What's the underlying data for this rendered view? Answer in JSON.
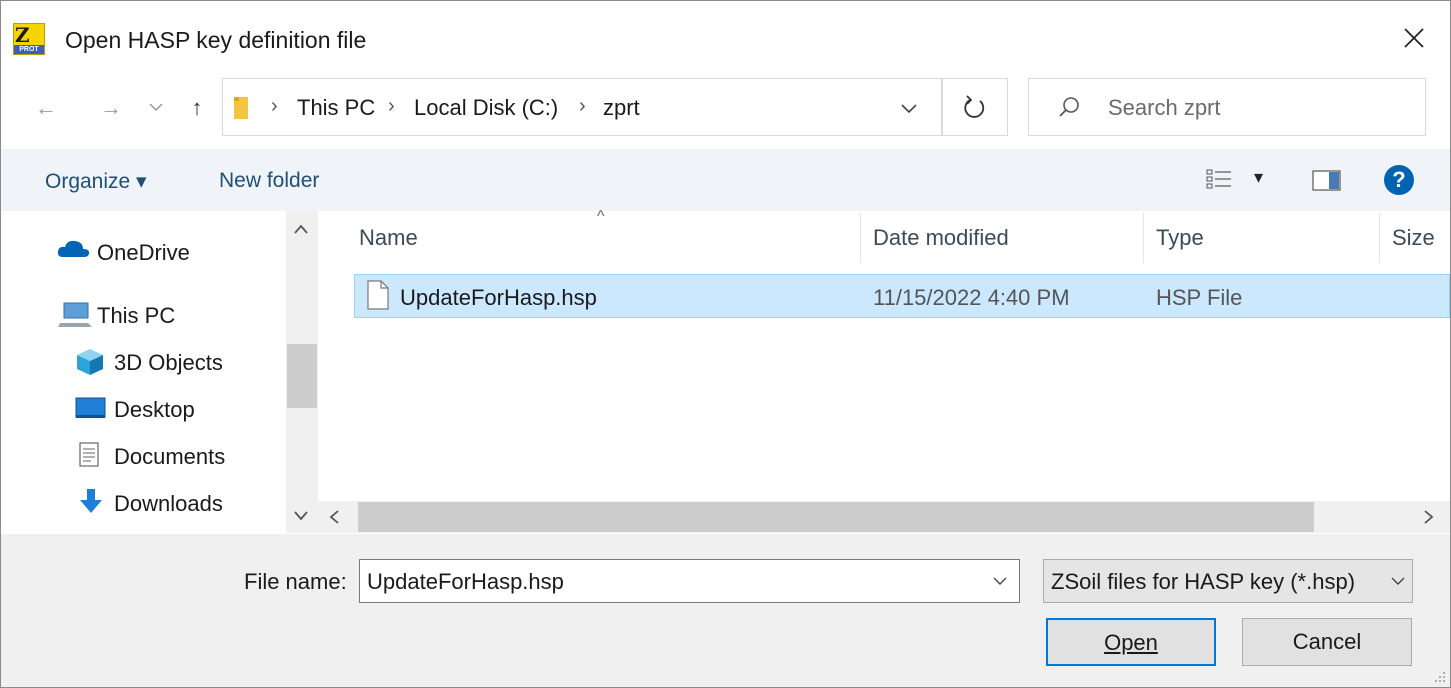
{
  "window": {
    "title": "Open HASP key definition file",
    "app_icon_letters": "Z",
    "app_icon_sub": "PROT",
    "close_glyph": "✕"
  },
  "nav": {
    "back_glyph": "←",
    "forward_glyph": "→",
    "recent_glyph": "⌄",
    "up_glyph": "↑"
  },
  "address": {
    "breadcrumbs": [
      "This PC",
      "Local Disk (C:)",
      "zprt"
    ],
    "separator": "›"
  },
  "search": {
    "placeholder": "Search zprt"
  },
  "toolbar": {
    "organize_label": "Organize ▾",
    "new_folder_label": "New folder",
    "view_dropdown_glyph": "▾",
    "help_glyph": "?"
  },
  "sidebar": {
    "items": [
      {
        "label": "OneDrive",
        "icon": "cloud-icon"
      },
      {
        "label": "This PC",
        "icon": "computer-icon"
      },
      {
        "label": "3D Objects",
        "icon": "cube-icon"
      },
      {
        "label": "Desktop",
        "icon": "desktop-icon"
      },
      {
        "label": "Documents",
        "icon": "documents-icon"
      },
      {
        "label": "Downloads",
        "icon": "download-icon"
      }
    ]
  },
  "file_list": {
    "columns": [
      "Name",
      "Date modified",
      "Type",
      "Size"
    ],
    "sort_glyph": "^",
    "rows": [
      {
        "name": "UpdateForHasp.hsp",
        "date": "11/15/2022 4:40 PM",
        "type": "HSP File",
        "size": "",
        "selected": true
      }
    ]
  },
  "bottom": {
    "file_name_label": "File name:",
    "file_name_value": "UpdateForHasp.hsp",
    "filter_value": "ZSoil files for HASP key (*.hsp)",
    "open_label": "Open",
    "cancel_label": "Cancel"
  },
  "colors": {
    "accent": "#0078d7",
    "selection": "#cce8ff",
    "toolbar_bg": "#f0f4f9",
    "help_blue": "#0063b1"
  }
}
